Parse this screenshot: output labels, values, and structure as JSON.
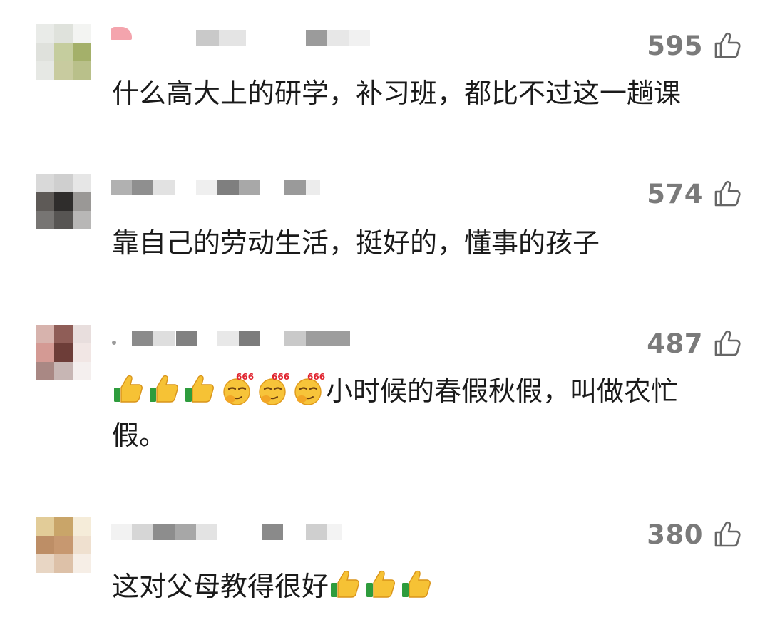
{
  "comments": [
    {
      "likes": "595",
      "text": "什么高大上的研学，补习班，都比不过这一趟课",
      "avatar_colors": [
        "#e9ebe8",
        "#dfe2dc",
        "#f3f4f2",
        "#dfe1dc",
        "#c5cd9e",
        "#a4b06a",
        "#e6e8e4",
        "#c8cb9f",
        "#b9c08a"
      ],
      "emojis_before": [],
      "emojis_after": []
    },
    {
      "likes": "574",
      "text": "靠自己的劳动生活，挺好的，懂事的孩子",
      "avatar_colors": [
        "#d9d9d9",
        "#cfcfcf",
        "#e6e6e6",
        "#5e5a57",
        "#2f2d2c",
        "#9a9896",
        "#777573",
        "#575553",
        "#b8b7b6"
      ],
      "emojis_before": [],
      "emojis_after": []
    },
    {
      "likes": "487",
      "text_line1": "小时候的春假秋假，叫做农忙",
      "text_line2": "假。",
      "avatar_colors": [
        "#d7b3ad",
        "#8f5d57",
        "#e8dedd",
        "#d49a94",
        "#6d3d38",
        "#f1e6e4",
        "#a98884",
        "#c7b6b4",
        "#f4efee"
      ],
      "emojis_before": [
        "thumbs-up",
        "thumbs-up",
        "thumbs-up",
        "smirk-666",
        "smirk-666",
        "smirk-666"
      ],
      "emojis_after": []
    },
    {
      "likes": "380",
      "text": "这对父母教得很好",
      "avatar_colors": [
        "#e2cc98",
        "#c9a569",
        "#f5ecd9",
        "#bd8e66",
        "#c79870",
        "#efe0cf",
        "#e8d6c4",
        "#ddc1a8",
        "#f6eee6"
      ],
      "emojis_before": [],
      "emojis_after": [
        "thumbs-up",
        "thumbs-up",
        "thumbs-up"
      ]
    }
  ]
}
